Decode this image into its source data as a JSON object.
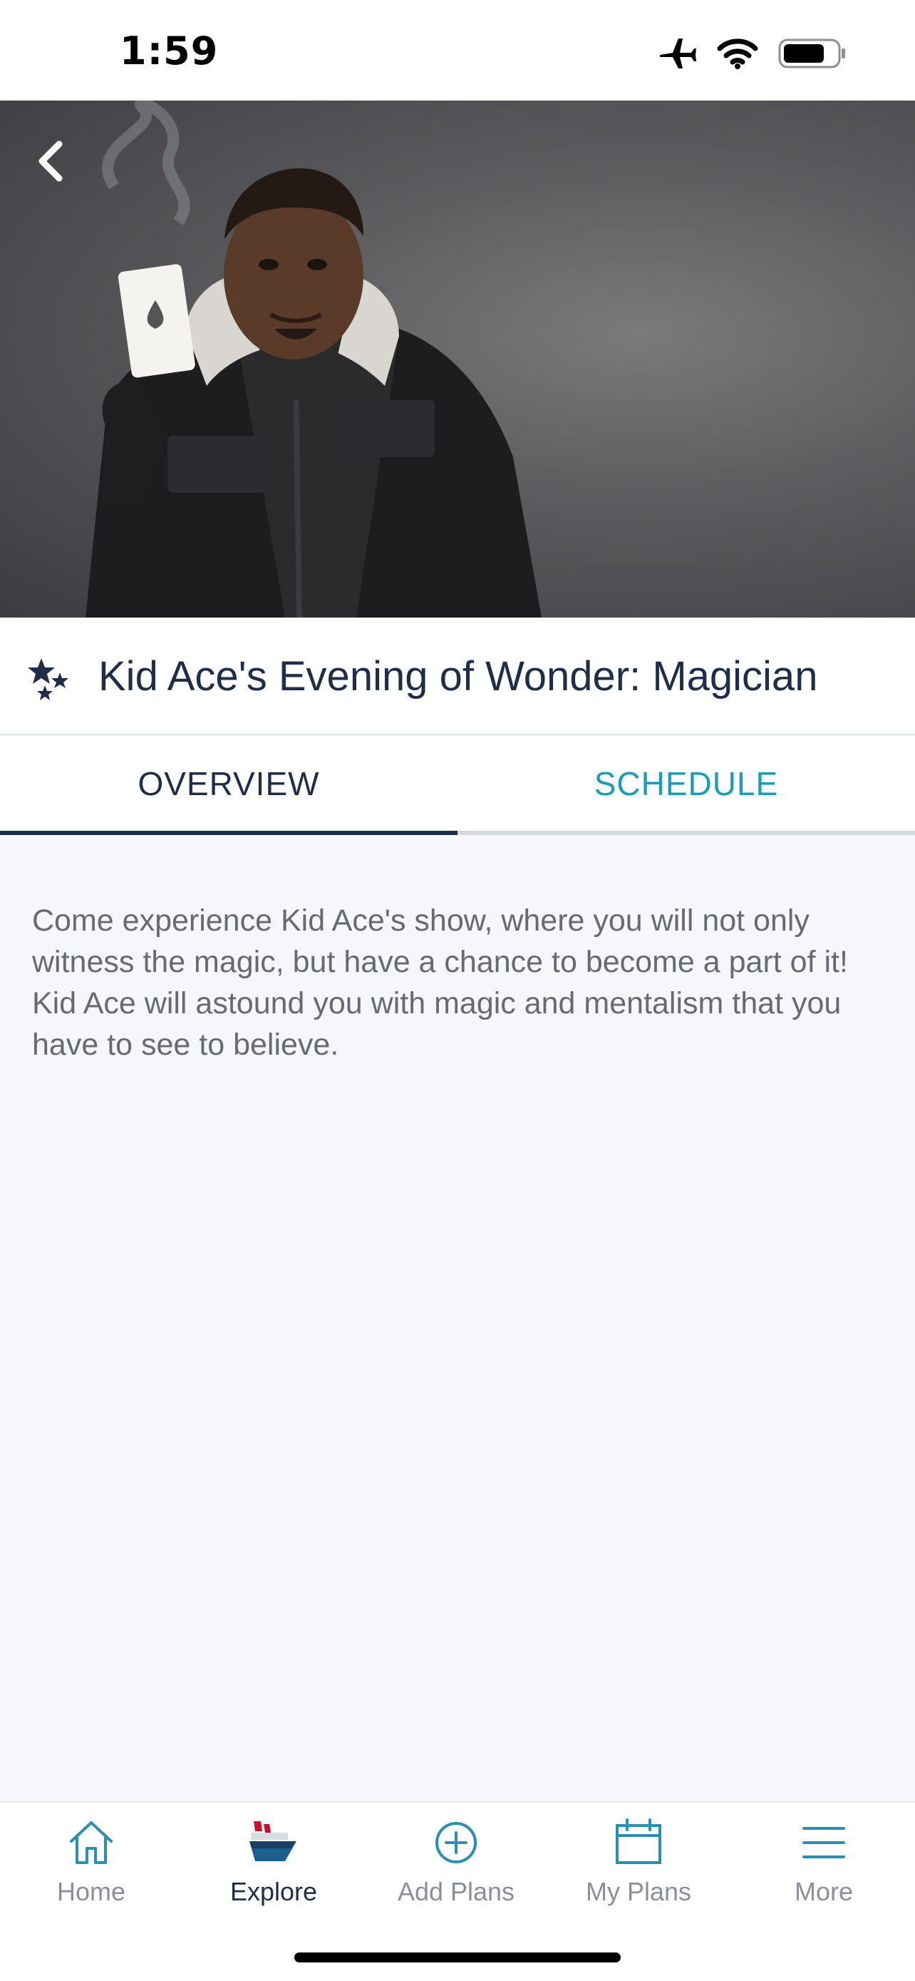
{
  "status_bar": {
    "time": "1:59"
  },
  "header": {
    "title": "Kid Ace's Evening of Wonder: Magician",
    "category_icon": "stars-icon"
  },
  "tabs": [
    {
      "label": "OVERVIEW",
      "active": true
    },
    {
      "label": "SCHEDULE",
      "active": false
    }
  ],
  "overview": {
    "description": "Come experience Kid Ace's show, where you will not only witness the magic, but have a chance to become a part of it! Kid Ace will astound you with magic and mentalism that you have to see to believe."
  },
  "bottom_nav": {
    "items": [
      {
        "label": "Home",
        "icon": "home-icon",
        "active": false
      },
      {
        "label": "Explore",
        "icon": "ship-icon",
        "active": true
      },
      {
        "label": "Add Plans",
        "icon": "add-circle-icon",
        "active": false
      },
      {
        "label": "My Plans",
        "icon": "calendar-icon",
        "active": false
      },
      {
        "label": "More",
        "icon": "menu-icon",
        "active": false
      }
    ]
  },
  "colors": {
    "navy": "#1f2d4b",
    "teal": "#1a9db5",
    "background": "#f6f7fb"
  }
}
